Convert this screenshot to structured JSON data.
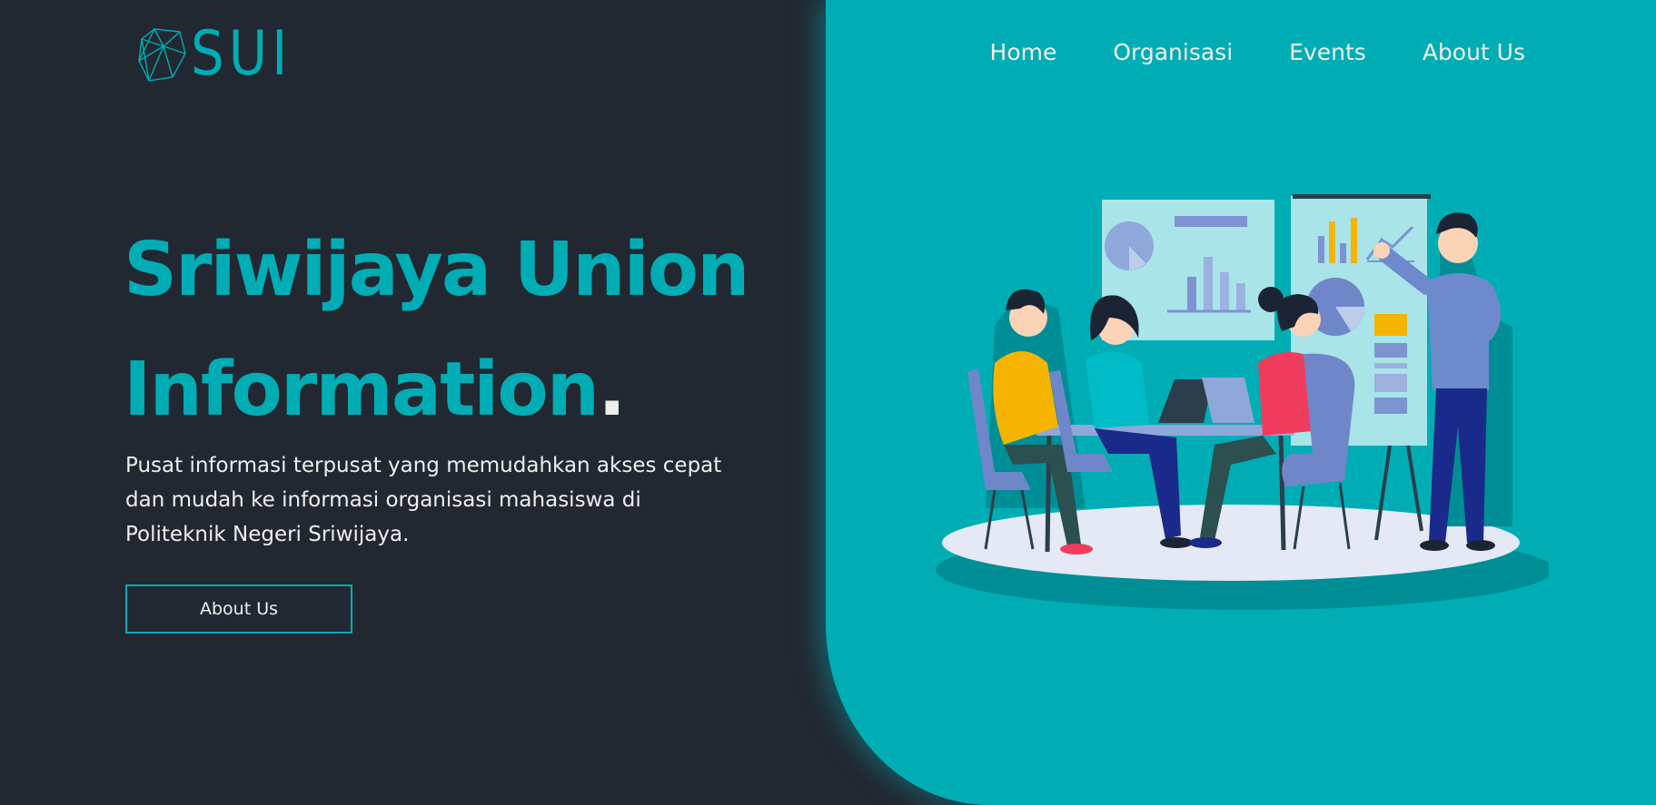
{
  "brand": {
    "logo_text": "SUI"
  },
  "nav": {
    "items": [
      "Home",
      "Organisasi",
      "Events",
      "About Us"
    ]
  },
  "hero": {
    "title_line1": "Sriwijaya Union",
    "title_line2": "Information",
    "title_dot": ".",
    "description": "Pusat informasi terpusat yang memudahkan akses cepat dan mudah ke informasi organisasi mahasiswa di Politeknik Negeri Sriwijaya.",
    "cta_label": "About Us"
  },
  "colors": {
    "accent": "#00ADB5",
    "background": "#222831",
    "text": "#EEEEEE"
  },
  "illustration": {
    "subject": "team-meeting-illustration"
  }
}
